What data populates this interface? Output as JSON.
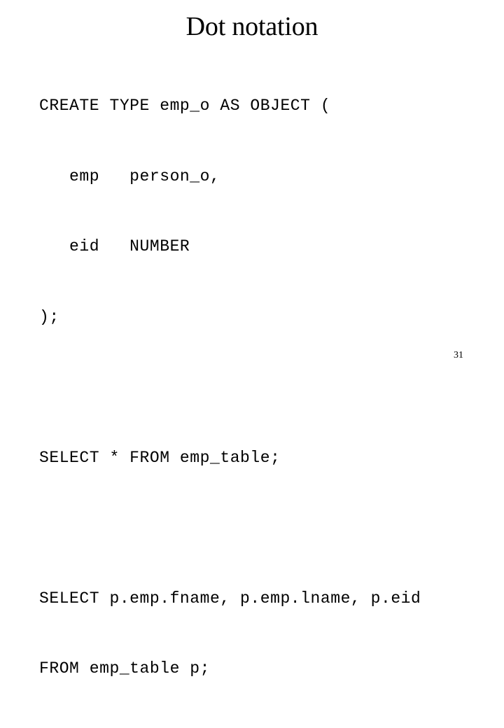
{
  "slide": {
    "title": "Dot notation",
    "page_number": "31",
    "background_color": "#ffffff",
    "text_color": "#000000",
    "code_lines": [
      "CREATE TYPE emp_o AS OBJECT (",
      "   emp   person_o,",
      "   eid   NUMBER",
      ");",
      "",
      "SELECT * FROM emp_table;",
      "",
      "SELECT p.emp.fname, p.emp.lname, p.eid",
      "FROM emp_table p;"
    ]
  }
}
